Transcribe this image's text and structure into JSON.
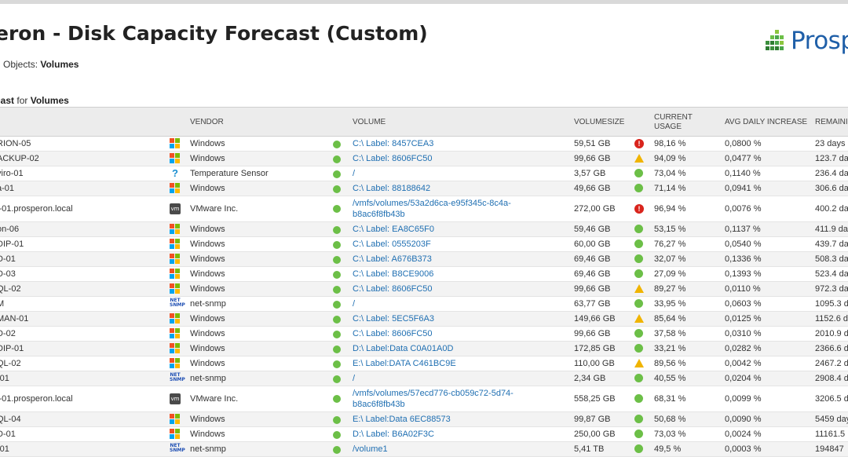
{
  "report": {
    "title": "eron - Disk Capacity Forecast (Custom)",
    "subtitle_prefix": "n Objects: ",
    "subtitle_value": "Volumes",
    "section_prefix": "cast",
    "section_for": " for ",
    "section_value": "Volumes"
  },
  "logo": {
    "text": "Prosp"
  },
  "colors": {
    "accent": "#1f6fb2",
    "ok": "#6cbf47",
    "critical": "#d9241c",
    "warning": "#f0b400",
    "header_bg": "#ececec"
  },
  "columns": {
    "vendor": "VENDOR",
    "volume": "VOLUME",
    "volumesize": "VOLUMESIZE",
    "current_usage_1": "CURRENT",
    "current_usage_2": "USAGE",
    "avg_daily_increase": "AVG DAILY INCREASE",
    "remaining": "REMAININ"
  },
  "rows": [
    {
      "name": "RION-05",
      "vendor_icon": "windows-icon",
      "vendor": "Windows",
      "volume": "C:\\ Label: 8457CEA3",
      "size": "59,51 GB",
      "status": "critical",
      "usage": "98,16 %",
      "avg": "0,0800 %",
      "remaining": "23 days"
    },
    {
      "name": "ACKUP-02",
      "vendor_icon": "windows-icon",
      "vendor": "Windows",
      "volume": "C:\\ Label: 8606FC50",
      "size": "99,66 GB",
      "status": "warning",
      "usage": "94,09 %",
      "avg": "0,0477 %",
      "remaining": "123.7 da"
    },
    {
      "name": "viro-01",
      "vendor_icon": "question-icon",
      "vendor": "Temperature Sensor",
      "volume": "/",
      "size": "3,57 GB",
      "status": "ok",
      "usage": "73,04 %",
      "avg": "0,1140 %",
      "remaining": "236.4 da"
    },
    {
      "name": "a-01",
      "vendor_icon": "windows-icon",
      "vendor": "Windows",
      "volume": "C:\\ Label: 88188642",
      "size": "49,66 GB",
      "status": "ok",
      "usage": "71,14 %",
      "avg": "0,0941 %",
      "remaining": "306.6 da"
    },
    {
      "name": "i-01.prosperon.local",
      "vendor_icon": "vmware-icon",
      "vendor": "VMware Inc.",
      "volume": "/vmfs/volumes/53a2d6ca-e95f345c-8c4a-",
      "volume2": "b8ac6f8fb43b",
      "size": "272,00 GB",
      "status": "critical",
      "usage": "96,94 %",
      "avg": "0,0076 %",
      "remaining": "400.2 da"
    },
    {
      "name": "on-06",
      "vendor_icon": "windows-icon",
      "vendor": "Windows",
      "volume": "C:\\ Label: EA8C65F0",
      "size": "59,46 GB",
      "status": "ok",
      "usage": "53,15 %",
      "avg": "0,1137 %",
      "remaining": "411.9 da"
    },
    {
      "name": "DIP-01",
      "vendor_icon": "windows-icon",
      "vendor": "Windows",
      "volume": "C:\\ Label: 0555203F",
      "size": "60,00 GB",
      "status": "ok",
      "usage": "76,27 %",
      "avg": "0,0540 %",
      "remaining": "439.7 da"
    },
    {
      "name": "D-01",
      "vendor_icon": "windows-icon",
      "vendor": "Windows",
      "volume": "C:\\ Label: A676B373",
      "size": "69,46 GB",
      "status": "ok",
      "usage": "32,07 %",
      "avg": "0,1336 %",
      "remaining": "508.3 da"
    },
    {
      "name": "D-03",
      "vendor_icon": "windows-icon",
      "vendor": "Windows",
      "volume": "C:\\ Label: B8CE9006",
      "size": "69,46 GB",
      "status": "ok",
      "usage": "27,09 %",
      "avg": "0,1393 %",
      "remaining": "523.4 da"
    },
    {
      "name": "QL-02",
      "vendor_icon": "windows-icon",
      "vendor": "Windows",
      "volume": "C:\\ Label: 8606FC50",
      "size": "99,66 GB",
      "status": "warning",
      "usage": "89,27 %",
      "avg": "0,0110 %",
      "remaining": "972.3 da"
    },
    {
      "name": "M",
      "vendor_icon": "snmp-icon",
      "vendor": "net-snmp",
      "volume": "/",
      "size": "63,77 GB",
      "status": "ok",
      "usage": "33,95 %",
      "avg": "0,0603 %",
      "remaining": "1095.3 d"
    },
    {
      "name": "MAN-01",
      "vendor_icon": "windows-icon",
      "vendor": "Windows",
      "volume": "C:\\ Label: 5EC5F6A3",
      "size": "149,66 GB",
      "status": "warning",
      "usage": "85,64 %",
      "avg": "0,0125 %",
      "remaining": "1152.6 d"
    },
    {
      "name": "D-02",
      "vendor_icon": "windows-icon",
      "vendor": "Windows",
      "volume": "C:\\ Label: 8606FC50",
      "size": "99,66 GB",
      "status": "ok",
      "usage": "37,58 %",
      "avg": "0,0310 %",
      "remaining": "2010.9 d"
    },
    {
      "name": "DIP-01",
      "vendor_icon": "windows-icon",
      "vendor": "Windows",
      "volume": "D:\\ Label:Data C0A01A0D",
      "size": "172,85 GB",
      "status": "ok",
      "usage": "33,21 %",
      "avg": "0,0282 %",
      "remaining": "2366.6 d"
    },
    {
      "name": "QL-02",
      "vendor_icon": "windows-icon",
      "vendor": "Windows",
      "volume": "E:\\ Label:DATA C461BC9E",
      "size": "110,00 GB",
      "status": "warning",
      "usage": "89,56 %",
      "avg": "0,0042 %",
      "remaining": "2467.2 d"
    },
    {
      "name": "-01",
      "vendor_icon": "snmp-icon",
      "vendor": "net-snmp",
      "volume": "/",
      "size": "2,34 GB",
      "status": "ok",
      "usage": "40,55 %",
      "avg": "0,0204 %",
      "remaining": "2908.4 d"
    },
    {
      "name": "i-01.prosperon.local",
      "vendor_icon": "vmware-icon",
      "vendor": "VMware Inc.",
      "volume": "/vmfs/volumes/57ecd776-cb059c72-5d74-",
      "volume2": "b8ac6f8fb43b",
      "size": "558,25 GB",
      "status": "ok",
      "usage": "68,31 %",
      "avg": "0,0099 %",
      "remaining": "3206.5 d"
    },
    {
      "name": "QL-04",
      "vendor_icon": "windows-icon",
      "vendor": "Windows",
      "volume": "E:\\ Label:Data 6EC88573",
      "size": "99,87 GB",
      "status": "ok",
      "usage": "50,68 %",
      "avg": "0,0090 %",
      "remaining": "5459 day"
    },
    {
      "name": "D-01",
      "vendor_icon": "windows-icon",
      "vendor": "Windows",
      "volume": "D:\\ Label: B6A02F3C",
      "size": "250,00 GB",
      "status": "ok",
      "usage": "73,03 %",
      "avg": "0,0024 %",
      "remaining": "11161.5"
    },
    {
      "name": "-01",
      "vendor_icon": "snmp-icon",
      "vendor": "net-snmp",
      "volume": "/volume1",
      "size": "5,41 TB",
      "status": "ok",
      "usage": "49,5 %",
      "avg": "0,0003 %",
      "remaining": "194847"
    }
  ]
}
